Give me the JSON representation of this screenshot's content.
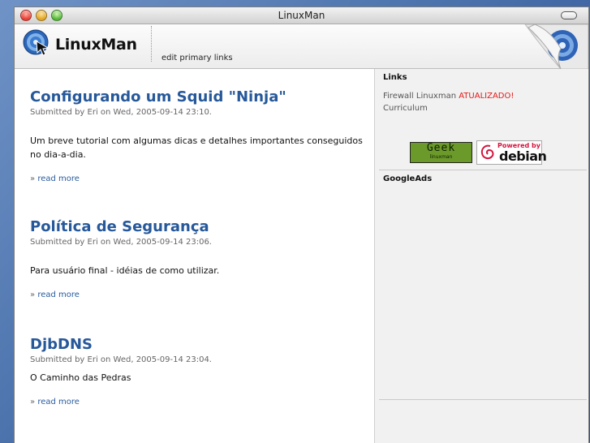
{
  "window": {
    "title": "LinuxMan"
  },
  "header": {
    "site_name": "LinuxMan",
    "primary_links": "edit primary links"
  },
  "nodes": [
    {
      "title": "Configurando um Squid \"Ninja\"",
      "submitted": "Submitted by Eri on Wed, 2005-09-14 23:10.",
      "body": "Um breve tutorial com algumas dicas e detalhes importantes conseguidos no dia-a-dia.",
      "more": "read more"
    },
    {
      "title": "Política de Segurança",
      "submitted": "Submitted by Eri on Wed, 2005-09-14 23:06.",
      "body": "Para usuário final - idéias de como utilizar.",
      "more": "read more"
    },
    {
      "title": "DjbDNS",
      "submitted": "Submitted by Eri on Wed, 2005-09-14 23:04.",
      "body": "O Caminho das Pedras",
      "more": "read more"
    }
  ],
  "more_arrow": "»",
  "sidebar": {
    "links_title": "Links",
    "link1_text": "Firewall Linuxman",
    "link1_highlight": "ATUALIZADO!",
    "link2_text": "Curriculum",
    "geek_badge": {
      "line1": "Geek",
      "line2": "linuxman"
    },
    "debian_badge": {
      "powered": "Powered by",
      "name": "debian"
    },
    "googleads_title": "GoogleAds"
  },
  "colors": {
    "accent": "#26589a",
    "highlight": "#e21b1b",
    "geek_green": "#6c9a2a"
  }
}
